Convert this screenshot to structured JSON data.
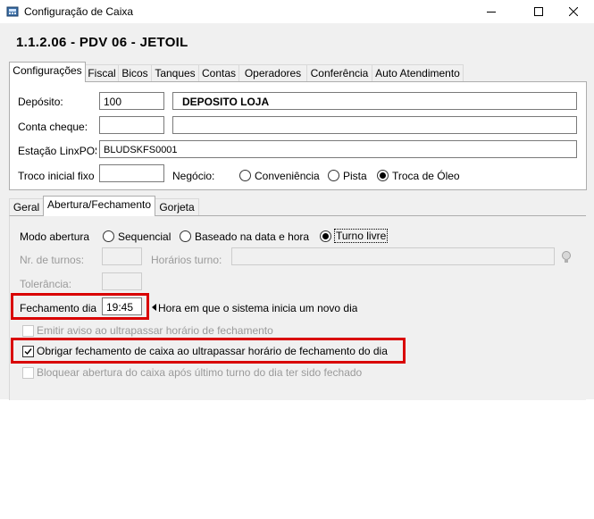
{
  "window": {
    "title": "Configuração de Caixa",
    "icon": "app-icon"
  },
  "header": {
    "title": "1.1.2.06 - PDV 06 - JETOIL"
  },
  "main_tabs": [
    {
      "label": "Configurações",
      "active": true
    },
    {
      "label": "Fiscal"
    },
    {
      "label": "Bicos"
    },
    {
      "label": "Tanques"
    },
    {
      "label": "Contas"
    },
    {
      "label": "Operadores"
    },
    {
      "label": "Conferência"
    },
    {
      "label": "Auto Atendimento"
    }
  ],
  "config": {
    "deposito_label": "Depósito:",
    "deposito_code": "100",
    "deposito_name": "DEPOSITO LOJA",
    "conta_cheque_label": "Conta cheque:",
    "conta_cheque_code": "",
    "conta_cheque_name": "",
    "estacao_label": "Estação LinxPOS",
    "estacao_value": "BLUDSKFS0001",
    "troco_label": "Troco inicial fixo",
    "troco_value": "",
    "negocio_label": "Negócio:",
    "negocio_options": [
      "Conveniência",
      "Pista",
      "Troca de Óleo"
    ],
    "negocio_selected": "Troca de Óleo"
  },
  "sub_tabs": [
    {
      "label": "Geral"
    },
    {
      "label": "Abertura/Fechamento",
      "active": true
    },
    {
      "label": "Gorjeta"
    }
  ],
  "abertura": {
    "modo_label": "Modo abertura",
    "modo_options": [
      "Sequencial",
      "Baseado na data e hora",
      "Turno livre"
    ],
    "modo_selected": "Turno livre",
    "nr_turnos_label": "Nr. de turnos:",
    "horarios_label": "Horários turno:",
    "tolerancia_label": "Tolerância:",
    "fechamento_label": "Fechamento dia",
    "fechamento_value": "19:45",
    "fechamento_hint": "Hora em que o sistema inicia um novo dia",
    "emitir_aviso_label": "Emitir aviso ao ultrapassar horário de fechamento",
    "emitir_aviso_checked": false,
    "obrigar_label": "Obrigar fechamento de caixa ao ultrapassar horário de fechamento do dia",
    "obrigar_checked": true,
    "bloquear_label": "Bloquear abertura do caixa após último turno do dia ter sido fechado",
    "bloquear_checked": false
  },
  "colors": {
    "highlight": "#d90000",
    "panel": "#f0f0f0"
  }
}
